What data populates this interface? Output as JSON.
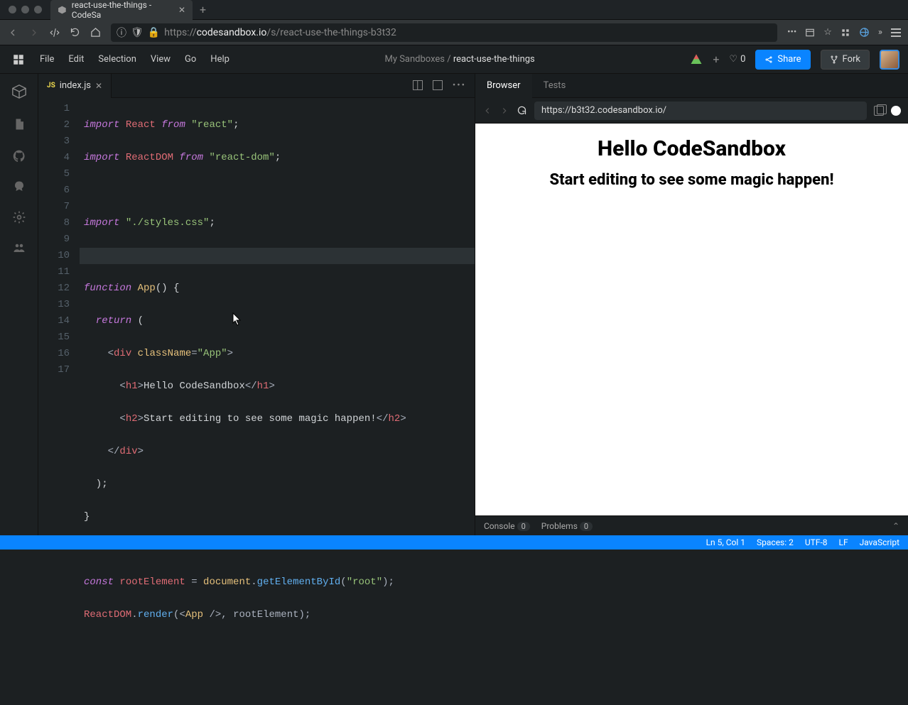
{
  "browser": {
    "tab_title": "react-use-the-things - CodeSa",
    "url_display": "https://codesandbox.io/s/react-use-the-things-b3t32",
    "url_host": "codesandbox.io",
    "url_scheme": "https://",
    "url_path": "/s/react-use-the-things-b3t32"
  },
  "menu": [
    "File",
    "Edit",
    "Selection",
    "View",
    "Go",
    "Help"
  ],
  "breadcrumb": {
    "prefix": "My Sandboxes / ",
    "title": "react-use-the-things"
  },
  "actions": {
    "likes": "0",
    "share": "Share",
    "fork": "Fork"
  },
  "file_tab": {
    "name": "index.js",
    "lang": "JS"
  },
  "line_numbers": [
    "1",
    "2",
    "3",
    "4",
    "5",
    "6",
    "7",
    "8",
    "9",
    "10",
    "11",
    "12",
    "13",
    "14",
    "15",
    "16",
    "17"
  ],
  "code": {
    "l1": {
      "kw1": "import",
      "v1": " React ",
      "kw2": "from",
      "s1": " \"react\"",
      "end": ";"
    },
    "l2": {
      "kw1": "import",
      "v1": " ReactDOM ",
      "kw2": "from",
      "s1": " \"react-dom\"",
      "end": ";"
    },
    "l4": {
      "kw1": "import",
      "s1": " \"./styles.css\"",
      "end": ";"
    },
    "l6": {
      "kw1": "function",
      "fn": " App",
      "rest": "() {"
    },
    "l7": {
      "kw1": "  return",
      "rest": " ("
    },
    "l8": {
      "open": "    <",
      "tag": "div",
      "attr": " className",
      "eq": "=",
      "str": "\"App\"",
      "close": ">"
    },
    "l9": {
      "open": "      <",
      "tag1": "h1",
      "gt": ">",
      "txt": "Hello CodeSandbox",
      "open2": "</",
      "tag2": "h1",
      "gt2": ">"
    },
    "l10": {
      "open": "      <",
      "tag1": "h2",
      "gt": ">",
      "txt": "Start editing to see some magic happen!",
      "open2": "</",
      "tag2": "h2",
      "gt2": ">"
    },
    "l11": {
      "open": "    </",
      "tag": "div",
      "gt": ">"
    },
    "l12": "  );",
    "l13": "}",
    "l15": {
      "kw": "const",
      "v": " rootElement ",
      "eq": "= ",
      "obj": "document",
      "dot": ".",
      "call": "getElementById",
      "paren": "(",
      "str": "\"root\"",
      "end": ");"
    },
    "l16": {
      "obj": "ReactDOM",
      "dot": ".",
      "call": "render",
      "rest": "(<",
      "tag": "App",
      "rest2": " />, rootElement);"
    }
  },
  "preview": {
    "tabs": {
      "browser": "Browser",
      "tests": "Tests"
    },
    "url": "https://b3t32.codesandbox.io/",
    "h1": "Hello CodeSandbox",
    "h2": "Start editing to see some magic happen!",
    "console": "Console",
    "console_count": "0",
    "problems": "Problems",
    "problems_count": "0"
  },
  "status": {
    "pos": "Ln 5, Col 1",
    "spaces": "Spaces: 2",
    "encoding": "UTF-8",
    "eol": "LF",
    "language": "JavaScript"
  }
}
